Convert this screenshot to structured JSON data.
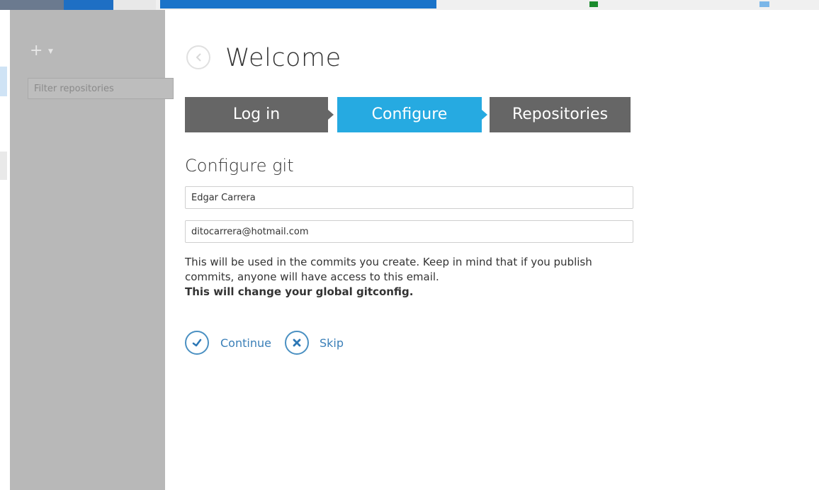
{
  "sidebar": {
    "filter_placeholder": "Filter repositories"
  },
  "header": {
    "title": "Welcome"
  },
  "steps": [
    {
      "label": "Log in",
      "active": false
    },
    {
      "label": "Configure",
      "active": true
    },
    {
      "label": "Repositories",
      "active": false
    }
  ],
  "configure": {
    "title": "Configure git",
    "name_value": "Edgar Carrera",
    "email_value": "ditocarrera@hotmail.com",
    "description": "This will be used in the commits you create. Keep in mind that if you publish commits, anyone will have access to this email.",
    "warning": "This will change your global gitconfig."
  },
  "actions": {
    "continue_label": "Continue",
    "skip_label": "Skip"
  },
  "colors": {
    "accent": "#26aae1",
    "step_inactive": "#666666",
    "sidebar": "#b8b8b8",
    "link": "#3a7fb8"
  },
  "icons": {
    "back": "chevron-left-icon",
    "add": "plus-icon",
    "continue": "check-icon",
    "skip": "close-icon"
  }
}
